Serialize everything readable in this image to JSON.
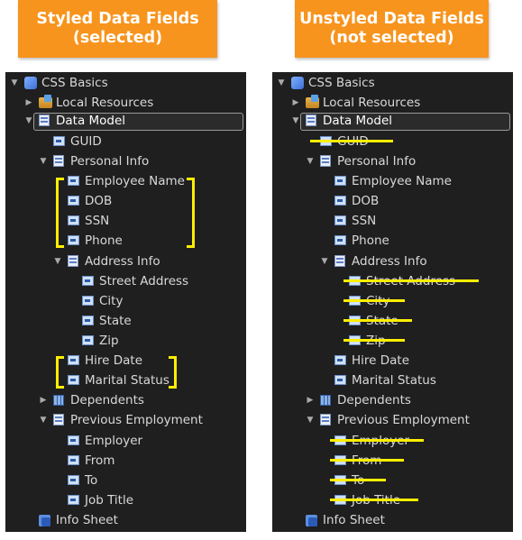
{
  "banners": {
    "left": {
      "line1": "Styled Data Fields",
      "line2": "(selected)"
    },
    "right": {
      "line1": "Unstyled Data Fields",
      "line2": "(not selected)"
    }
  },
  "tree": [
    {
      "label": "CSS Basics",
      "icon": "css-icon",
      "expander": "expanded"
    },
    {
      "label": "Local Resources",
      "icon": "folder-icon",
      "expander": "collapsed"
    },
    {
      "label": "Data Model",
      "icon": "data-model-icon",
      "expander": "expanded",
      "selected": true
    },
    {
      "label": "GUID",
      "icon": "field-icon"
    },
    {
      "label": "Personal Info",
      "icon": "group-icon",
      "expander": "expanded"
    },
    {
      "label": "Employee Name",
      "icon": "field-icon"
    },
    {
      "label": "DOB",
      "icon": "field-icon"
    },
    {
      "label": "SSN",
      "icon": "field-icon"
    },
    {
      "label": "Phone",
      "icon": "field-icon"
    },
    {
      "label": "Address Info",
      "icon": "group-icon",
      "expander": "expanded"
    },
    {
      "label": "Street Address",
      "icon": "field-icon"
    },
    {
      "label": "City",
      "icon": "field-icon"
    },
    {
      "label": "State",
      "icon": "field-icon"
    },
    {
      "label": "Zip",
      "icon": "field-icon"
    },
    {
      "label": "Hire Date",
      "icon": "field-icon"
    },
    {
      "label": "Marital Status",
      "icon": "field-icon"
    },
    {
      "label": "Dependents",
      "icon": "table-icon",
      "expander": "collapsed"
    },
    {
      "label": "Previous Employment",
      "icon": "group-icon",
      "expander": "expanded"
    },
    {
      "label": "Employer",
      "icon": "field-icon"
    },
    {
      "label": "From",
      "icon": "field-icon"
    },
    {
      "label": "To",
      "icon": "field-icon"
    },
    {
      "label": "Job Title",
      "icon": "field-icon"
    },
    {
      "label": "Info Sheet",
      "icon": "info-sheet-icon"
    }
  ],
  "colors": {
    "banner": "#f7941d",
    "panel": "#1f1f1f",
    "highlight": "#ffee00",
    "text": "#d9d9d9"
  }
}
